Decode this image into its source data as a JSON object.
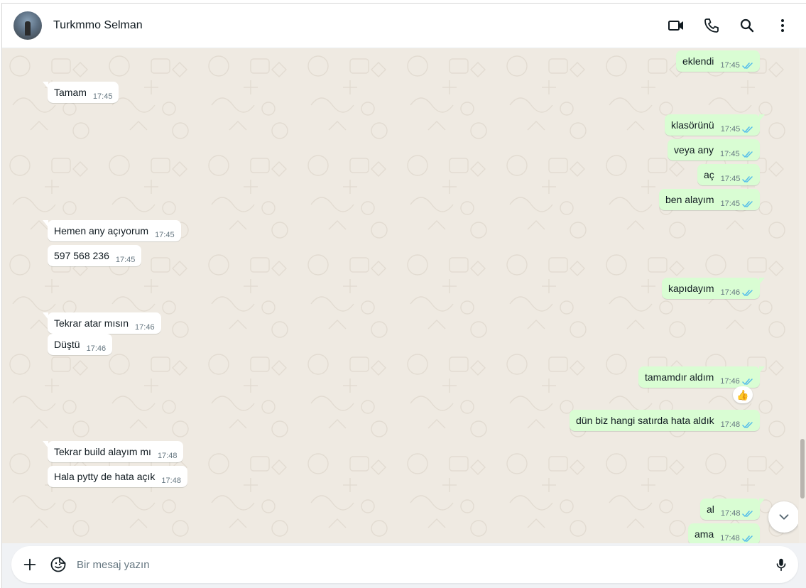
{
  "header": {
    "contact_name": "Turkmmo Selman",
    "icons": [
      "video-call-icon",
      "voice-call-icon",
      "search-icon",
      "menu-icon"
    ]
  },
  "messages": [
    {
      "dir": "out",
      "text": "eklendi",
      "time": "17:45",
      "ticks": "read"
    },
    {
      "dir": "in",
      "text": "Tamam",
      "time": "17:45"
    },
    {
      "dir": "out",
      "text": "klasörünü",
      "time": "17:45",
      "ticks": "read"
    },
    {
      "dir": "out",
      "text": "veya any",
      "time": "17:45",
      "ticks": "read"
    },
    {
      "dir": "out",
      "text": "aç",
      "time": "17:45",
      "ticks": "read"
    },
    {
      "dir": "out",
      "text": "ben alayım",
      "time": "17:45",
      "ticks": "read"
    },
    {
      "dir": "in",
      "text": "Hemen any açıyorum",
      "time": "17:45"
    },
    {
      "dir": "in",
      "text": "597 568 236",
      "time": "17:45"
    },
    {
      "dir": "out",
      "text": "kapıdayım",
      "time": "17:46",
      "ticks": "read"
    },
    {
      "dir": "in",
      "text": "Tekrar atar mısın",
      "time": "17:46"
    },
    {
      "dir": "in",
      "text": "Düştü",
      "time": "17:46"
    },
    {
      "dir": "out",
      "text": "tamamdır aldım",
      "time": "17:46",
      "ticks": "read",
      "reaction": "👍"
    },
    {
      "dir": "out",
      "text": "dün biz hangi satırda hata aldık",
      "time": "17:48",
      "ticks": "read"
    },
    {
      "dir": "in",
      "text": "Tekrar build alayım mı",
      "time": "17:48"
    },
    {
      "dir": "in",
      "text": "Hala pytty de hata açık",
      "time": "17:48"
    },
    {
      "dir": "out",
      "text": "al",
      "time": "17:48",
      "ticks": "read"
    },
    {
      "dir": "out",
      "text": "ama",
      "time": "17:48",
      "ticks": "read"
    }
  ],
  "composer": {
    "placeholder": "Bir mesaj yazın"
  },
  "colors": {
    "incoming_bubble": "#ffffff",
    "outgoing_bubble": "#d9fdd3",
    "read_ticks": "#53bdeb",
    "chat_background": "#efeae2"
  }
}
